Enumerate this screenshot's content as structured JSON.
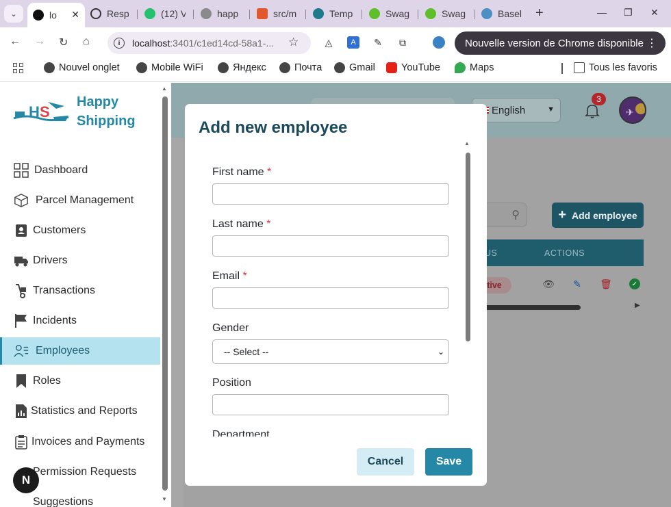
{
  "browser": {
    "tabs": [
      {
        "title": "lo",
        "active": true
      },
      {
        "title": "Resp"
      },
      {
        "title": "(12) V"
      },
      {
        "title": "happ"
      },
      {
        "title": "src/m"
      },
      {
        "title": "Temp"
      },
      {
        "title": "Swag"
      },
      {
        "title": "Swag"
      },
      {
        "title": "Basel"
      }
    ],
    "url_host": "localhost",
    "url_path": ":3401/c1ed14cd-58a1-...",
    "update_pill": "Nouvelle version de Chrome disponible",
    "bookmarks": [
      "Nouvel onglet",
      "Mobile WiFi",
      "Яндекс",
      "Почта",
      "Gmail",
      "YouTube",
      "Maps"
    ],
    "all_bookmarks": "Tous les favoris"
  },
  "app": {
    "brand_line1": "Happy",
    "brand_line2": "Shipping",
    "brand_color": "#2488a6",
    "menu": [
      {
        "label": "Dashboard",
        "icon": "grid-icon"
      },
      {
        "label": "Parcel Management",
        "icon": "box-icon"
      },
      {
        "label": "Customers",
        "icon": "contact-card-icon"
      },
      {
        "label": "Drivers",
        "icon": "truck-icon"
      },
      {
        "label": "Transactions",
        "icon": "hand-truck-icon"
      },
      {
        "label": "Incidents",
        "icon": "flag-icon"
      },
      {
        "label": "Employees",
        "icon": "user-list-icon",
        "active": true
      },
      {
        "label": "Roles",
        "icon": "bookmark-icon"
      },
      {
        "label": "Statistics and Reports",
        "icon": "report-icon"
      },
      {
        "label": "Invoices and Payments",
        "icon": "clipboard-icon"
      },
      {
        "label": "Permission Requests",
        "icon": "lock-icon"
      },
      {
        "label": "Suggestions",
        "icon": "lightbulb-icon"
      }
    ],
    "header": {
      "language": "English",
      "notifications_count": "3"
    },
    "table": {
      "add_button": "Add employee",
      "columns": [
        "US",
        "ACTIONS"
      ],
      "row_status": "ctive"
    }
  },
  "modal": {
    "title": "Add new employee",
    "fields": [
      {
        "label": "First name",
        "required": true,
        "value": ""
      },
      {
        "label": "Last name",
        "required": true,
        "value": ""
      },
      {
        "label": "Email",
        "required": true,
        "value": ""
      },
      {
        "label": "Gender",
        "type": "select",
        "value": "-- Select --"
      },
      {
        "label": "Position",
        "value": ""
      },
      {
        "label": "Department",
        "value": ""
      }
    ],
    "required_mark": "*",
    "cancel": "Cancel",
    "save": "Save"
  }
}
